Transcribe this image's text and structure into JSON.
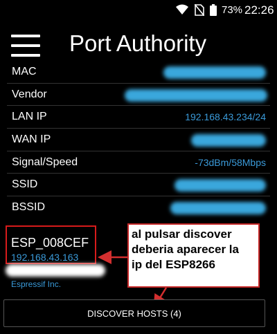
{
  "status_bar": {
    "battery_percent": "73%",
    "time": "22:26",
    "icons": [
      "wifi-icon",
      "no-sim-icon",
      "battery-icon"
    ]
  },
  "app": {
    "title": "Port Authority"
  },
  "info": {
    "rows": [
      {
        "label": "MAC",
        "value": ""
      },
      {
        "label": "Vendor",
        "value": ""
      },
      {
        "label": "LAN IP",
        "value": "192.168.43.234/24"
      },
      {
        "label": "WAN IP",
        "value": ""
      },
      {
        "label": "Signal/Speed",
        "value": "-73dBm/58Mbps"
      },
      {
        "label": "SSID",
        "value": ""
      },
      {
        "label": "BSSID",
        "value": ""
      }
    ]
  },
  "host": {
    "name": "ESP_008CEF",
    "ip": "192.168.43.163",
    "vendor": "Espressif Inc."
  },
  "annotation": {
    "line1": "al pulsar discover",
    "line2": "deberia aparecer la",
    "line3": "ip del ESP8266"
  },
  "discover": {
    "label": "DISCOVER HOSTS (4)"
  },
  "colors": {
    "accent": "#3a9ad9",
    "background": "#000000",
    "annotation_border": "#c62828"
  }
}
